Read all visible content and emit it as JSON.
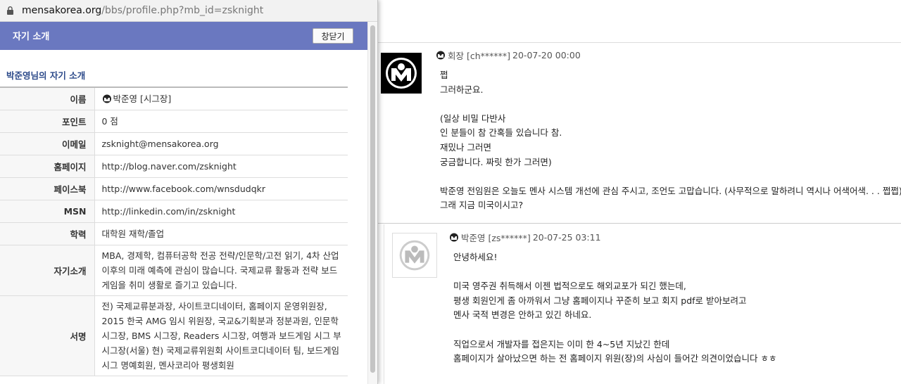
{
  "browser": {
    "url_host": "mensakorea.org",
    "url_path": "/bbs/profile.php?mb_id=zsknight"
  },
  "popup": {
    "title": "자기 소개",
    "close_label": "창닫기",
    "section_title": "박준영님의 자기 소개",
    "fields": {
      "name_label": "이름",
      "name_value": "박준영 [시그장]",
      "points_label": "포인트",
      "points_value": "0 점",
      "email_label": "이메일",
      "email_value": "zsknight@mensakorea.org",
      "homepage_label": "홈페이지",
      "homepage_value": "http://blog.naver.com/zsknight",
      "facebook_label": "페이스북",
      "facebook_value": "http://www.facebook.com/wnsdudqkr",
      "msn_label": "MSN",
      "msn_value": "http://linkedin.com/in/zsknight",
      "education_label": "학력",
      "education_value": "대학원 재학/졸업",
      "intro_label": "자기소개",
      "intro_value": "MBA, 경제학, 컴퓨터공학 전공 전략/인문학/고전 읽기, 4차 산업 이후의 미래 예측에 관심이 많습니다. 국제교류 활동과 전략 보드게임을 취미 생활로 즐기고 있습니다.",
      "signature_label": "서명",
      "signature_value": "전) 국제교류분과장, 사이트코디네이터, 홈페이지 운영위원장, 2015 한국 AMG 임시 위원장, 국교&기획분과 정분과원, 인문학 시그장, BMS 시그장, Readers 시그장, 여행과 보드게임 시그 부시그장(서울) 현) 국제교류위원회 사이트코디네이터 팀, 보드게임 시그 명예회원, 멘사코리아 평생회원"
    }
  },
  "comments": [
    {
      "author": "회장 [ch******]",
      "date": "20-07-20 00:00",
      "body": "쩝\n그러하군요.\n\n(일상 비밀 다반사\n인 분들이 참 간혹들 있습니다 참.\n재밌나 그러면\n궁금합니다. 짜릿 한가 그러면)\n\n박준영 전임원은 오늘도 멘사 시스템 개선에 관심 주시고, 조언도 고맙습니다. (사무적으로 말하려니 역시나 어색어색. . . 쩝쩝)\n그래 지금 미국이시고?"
    },
    {
      "author": "박준영 [zs******]",
      "date": "20-07-25 03:11",
      "body": "안녕하세요!\n\n미국 영주권 취득해서 이젠 법적으로도 해외교포가 되긴 했는데,\n평생 회원인게 좀 아까워서 그냥 홈페이지나 꾸준히 보고 회지 pdf로 받아보려고\n멘사 국적 변경은 안하고 있긴 하네요.\n\n직업으로서 개발자를 접은지는 이미 한 4~5년 지났긴 한데\n홈페이지가 살아났으면 하는 전 홈페이지 위원(장)의 사심이 들어간 의견이었습니다 ㅎㅎ"
    }
  ],
  "colors": {
    "popup_header": "#6a78c0",
    "section_title": "#2c4a8a"
  }
}
